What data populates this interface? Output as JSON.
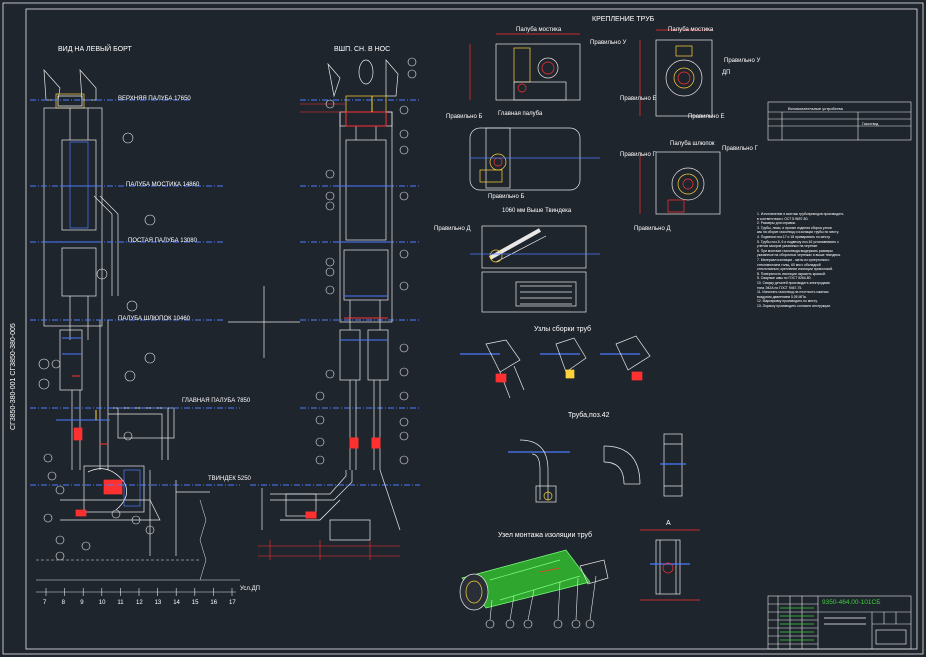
{
  "sheet": {
    "side_code": "СГ3850-380-001 СГ3850-380-005",
    "drawing_number": "9350-464.00-101СБ"
  },
  "views": {
    "left_title": "ВИД НА ЛЕВЫЙ БОРТ",
    "mid_title": "ВШП. СН. В НОС",
    "fastening_title": "КРЕПЛЕНИЕ ТРУБ",
    "assembly_title": "Узлы сборки труб",
    "pipe_pos_title": "Труба,поз.42",
    "insulation_title": "Узел монтажа изоляции труб",
    "view_a": "А"
  },
  "decks": [
    {
      "label": "ВЕРХНЯЯ ПАЛУБА 17650"
    },
    {
      "label": "ПАЛУБА МОСТИКА 14860"
    },
    {
      "label": "ПОСТАЯ ПАЛУБА 13080"
    },
    {
      "label": "ПАЛУБА ШЛЮПОК 10460"
    },
    {
      "label": "ГЛАВНАЯ ПАЛУБА 7850"
    },
    {
      "label": "ТВИНДЕК 5250"
    }
  ],
  "fastening_labels": {
    "top_left_view": "Палуба мостика",
    "top_right_view": "Палуба мостика",
    "main_deck_view": "Главная палуба",
    "boat_deck_view": "Палуба шлюпок",
    "twindeck_view": "1060 мм Выше Твиндека",
    "arrow_v": "Правильно У",
    "arrow_v2": "Правильно У",
    "arrow_b": "Правильно Б",
    "arrow_b2": "Правильно Б",
    "arrow_e": "Правильно Е",
    "arrow_e2": "Правильно Е",
    "arrow_g": "Правильно Г",
    "arrow_g2": "Правильно Г",
    "arrow_d": "Правильно Д",
    "arrow_d2": "Правильно Д",
    "dp": "ДП"
  },
  "scale": {
    "ticks": [
      "7",
      "8",
      "9",
      "10",
      "11",
      "12",
      "13",
      "14",
      "15",
      "16",
      "17"
    ],
    "unit_label": "Усл.ДП"
  },
  "stamp_table": {
    "title": "Вспомогательные устройства",
    "sub": "Газоотвод"
  },
  "notes": [
    "1. Изготовление и монтаж трубопроводов производить",
    "в соответствии с ОСТ 5.9697-80.",
    "2. Размеры для справок.",
    "3. Трубы, люки, и прочие изделия сборка узлов",
    "как на сборке газоотвод и изоляции трубы по месту.",
    "4. Подвески поз.17 и 18 приваривать по месту.",
    "5. Трубы поз.5, 6 и подвеску поз.16 устанавливать с",
    "учетом зазоров указанных на чертеже.",
    "6. При монтаже газоотвода выдержать размеры",
    "указанные на сборочных чертежах и выше твиндека.",
    "7. Материал изоляции - маты из супертонкого",
    "стекловолокна толщ. 60 мм с обкладкой",
    "стеклотканью; крепление изоляции проволокой.",
    "8. Поверхность изоляции окрасить краской.",
    "9. Сварные швы по ГОСТ 5264-80.",
    "10. Сварку деталей производить электродами",
    "типа Э42А по ГОСТ 9467-75.",
    "11. Испытать газоотвод на плотность сжатым",
    "воздухом давлением 0,05 МПа.",
    "12. Маркировку производить по месту.",
    "13. Окраску производить согласно инструкции."
  ]
}
